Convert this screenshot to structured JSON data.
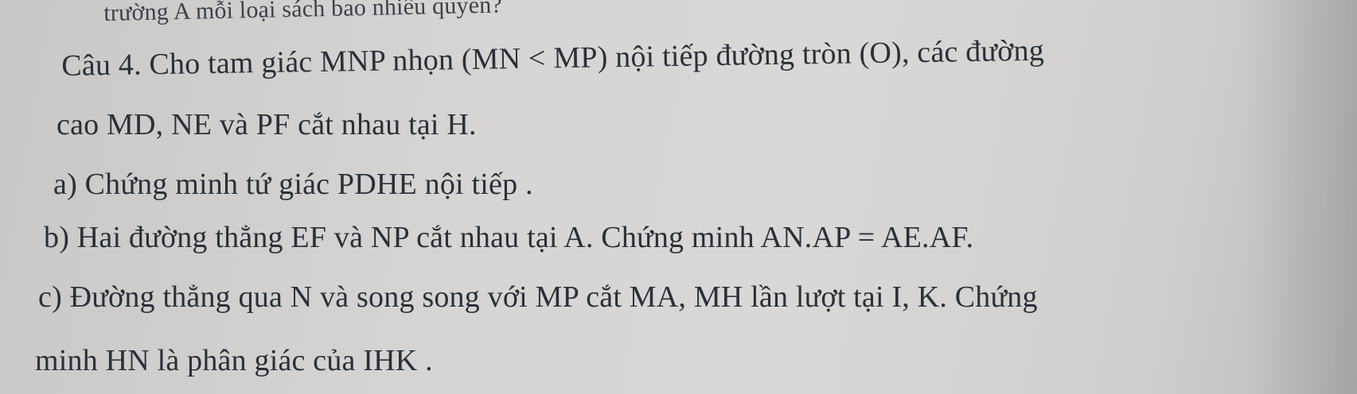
{
  "document": {
    "lines": [
      "trường A mỗi loại sách bao nhiêu quyển?",
      "Câu 4. Cho tam giác MNP nhọn (MN < MP) nội tiếp đường tròn (O), các đường",
      "cao MD, NE và PF cắt nhau tại H.",
      "a) Chứng minh tứ giác PDHE nội tiếp .",
      "b) Hai đường thẳng EF và NP cắt nhau tại A. Chứng minh AN.AP = AE.AF.",
      "c) Đường thẳng qua N và song song với MP cắt MA, MH lần lượt tại I, K. Chứng",
      "minh HN là phân giác của IHK ."
    ]
  }
}
